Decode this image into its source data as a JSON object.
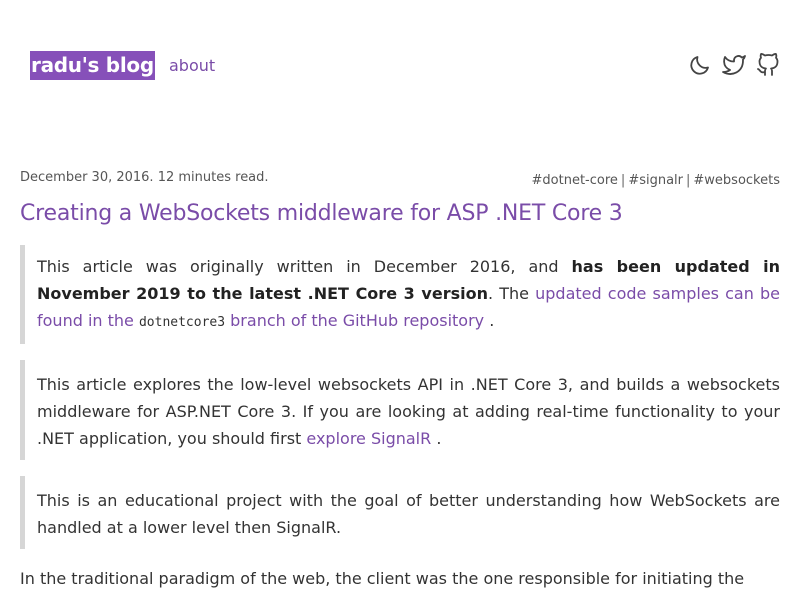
{
  "header": {
    "logo_text": "radu's blog",
    "nav_about": "about",
    "icons": [
      "moon-icon",
      "twitter-icon",
      "github-icon"
    ]
  },
  "post": {
    "date_line": "December 30, 2016. 12 minutes read.",
    "tags": [
      "#dotnet-core",
      "#signalr",
      "#websockets"
    ],
    "tag_separator": "|",
    "title": "Creating a WebSockets middleware for ASP .NET Core 3",
    "note1": {
      "intro": "This article was originally written in December 2016, and ",
      "bold": "has been updated in November 2019 to the latest .NET Core 3 version",
      "mid": ". The ",
      "link_before_code": "updated code samples can be found in the ",
      "code": "dotnetcore3",
      "link_after_code": " branch of the GitHub repository",
      "end": " ."
    },
    "note2": {
      "text": "This article explores the low-level websockets API in .NET Core 3, and builds a websockets middleware for ASP.NET Core 3. If you are looking at adding real-time functionality to your .NET application, you should first ",
      "link": "explore SignalR",
      "end": " ."
    },
    "note3": {
      "text": "This is an educational project with the goal of better understanding how WebSockets are handled at a lower level then SignalR."
    },
    "paragraph1": "In the traditional paradigm of the web, the client was the one responsible for initiating the"
  },
  "colors": {
    "accent": "#7a4ca8",
    "logo_bg": "#8650b9",
    "quote_border": "#d6d6d6",
    "text": "#333333"
  }
}
